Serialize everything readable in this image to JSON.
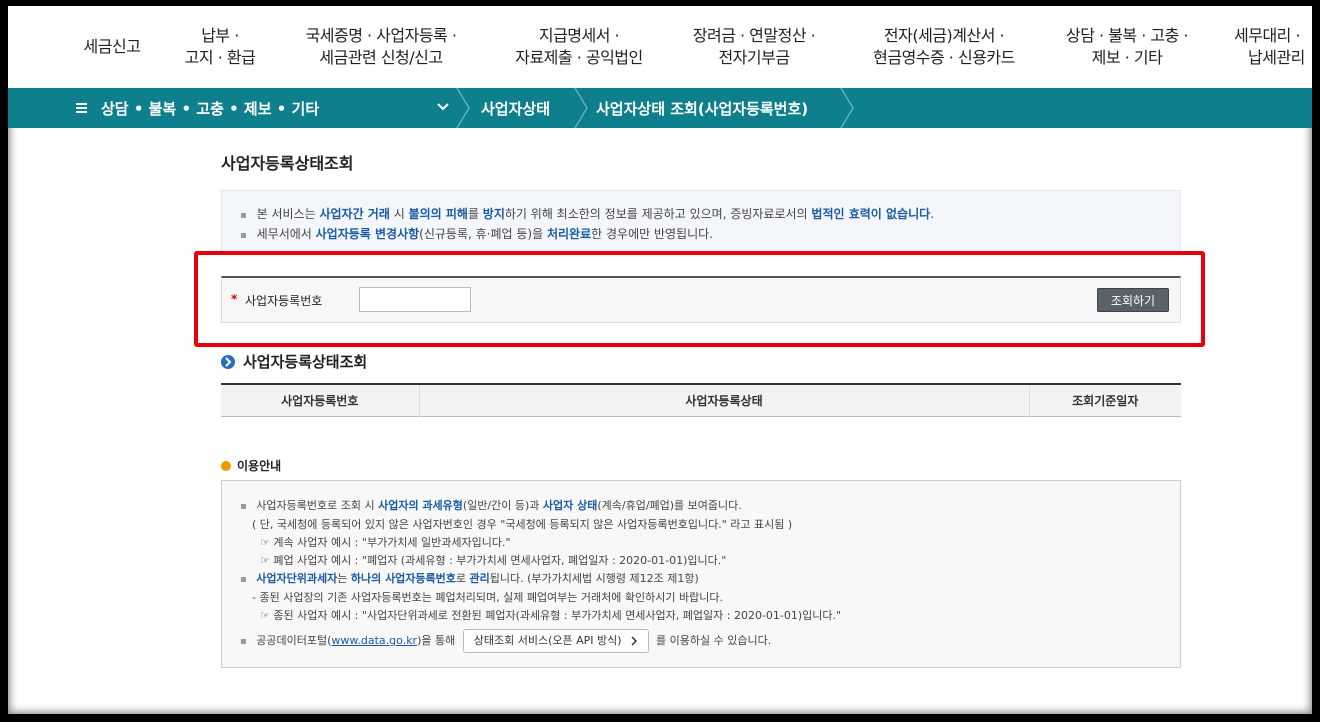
{
  "nav": {
    "items": [
      {
        "line1": "세금신고",
        "line2": ""
      },
      {
        "line1": "납부 · ",
        "line2": "고지 · 환급"
      },
      {
        "line1": "국세증명 · 사업자등록 · ",
        "line2": "세금관련 신청/신고"
      },
      {
        "line1": "지급명세서 · ",
        "line2": "자료제출 · 공익법인"
      },
      {
        "line1": "장려금 · 연말정산 · ",
        "line2": "전자기부금"
      },
      {
        "line1": "전자(세금)계산서 · ",
        "line2": "현금영수증 · 신용카드"
      },
      {
        "line1": "상담 · 불복 · 고충 · ",
        "line2": "제보 · 기타"
      },
      {
        "line1": "세무대리 · ",
        "line2": "납세관리"
      }
    ]
  },
  "breadcrumb": {
    "menu": "상담 • 불복 • 고충 • 제보 • 기타",
    "level2": "사업자상태",
    "level3": "사업자상태 조회(사업자등록번호)"
  },
  "page": {
    "title": "사업자등록상태조회"
  },
  "notice": {
    "l1_a": "본 서비스는 ",
    "l1_b": "사업자간 거래",
    "l1_c": " 시 ",
    "l1_d": "불의의 피해",
    "l1_e": "를 ",
    "l1_f": "방지",
    "l1_g": "하기 위해 최소한의 정보를 제공하고 있으며, 증빙자료로서의 ",
    "l1_h": "법적인 효력이 없습니다",
    "l1_i": ".",
    "l2_a": "세무서에서 ",
    "l2_b": "사업자등록 변경사항",
    "l2_c": "(신규등록, 휴·폐업 등)을 ",
    "l2_d": "처리완료",
    "l2_e": "한 경우에만 반영됩니다."
  },
  "search": {
    "required_mark": "*",
    "label": "사업자등록번호",
    "value": "",
    "button": "조회하기"
  },
  "result": {
    "title": "사업자등록상태조회",
    "columns": [
      "사업자등록번호",
      "사업자등록상태",
      "조회기준일자"
    ]
  },
  "guide": {
    "title": "이용안내",
    "g1_a": "사업자등록번호로 조회 시 ",
    "g1_b": "사업자의 과세유형",
    "g1_c": "(일반/간이 등)과 ",
    "g1_d": "사업자 상태",
    "g1_e": "(계속/휴업/폐업)를 보여줍니다.",
    "g2": "( 단, 국세청에 등록되어 있지 않은 사업자번호인 경우 \"국세청에 등록되지 않은 사업자등록번호입니다.\" 라고 표시됨 )",
    "g3": "☞ 계속 사업자 예시 : \"부가가치세 일반과세자입니다.\"",
    "g4": "☞ 폐업 사업자 예시 : \"폐업자 (과세유형 : 부가가치세 면세사업자, 폐업일자 : 2020-01-01)입니다.\"",
    "g5_a": "사업자단위과세자",
    "g5_b": "는 ",
    "g5_c": "하나의 사업자등록번호",
    "g5_d": "로 ",
    "g5_e": "관리",
    "g5_f": "됩니다. (부가가치세법 시행령 제12조 제1항)",
    "g6": "- 종된 사업장의 기존 사업자등록번호는 폐업처리되며, 실제 폐업여부는 거래처에 확인하시기 바랍니다.",
    "g7": "☞ 종된 사업자 예시 : \"사업자단위과세로 전환된 폐업자(과세유형 : 부가가치세 면세사업자, 폐업일자 : 2020-01-01)입니다.\"",
    "g8_a": "공공데이터포털(",
    "g8_link": "www.data.go.kr",
    "g8_b": ")을 통해 ",
    "g8_btn": "상태조회 서비스(오픈 API 방식)",
    "g8_c": " 를 이용하실 수 있습니다."
  },
  "colors": {
    "accent": "#0e7f8c",
    "highlight": "#1b5aa6",
    "alert": "#e8000b"
  }
}
